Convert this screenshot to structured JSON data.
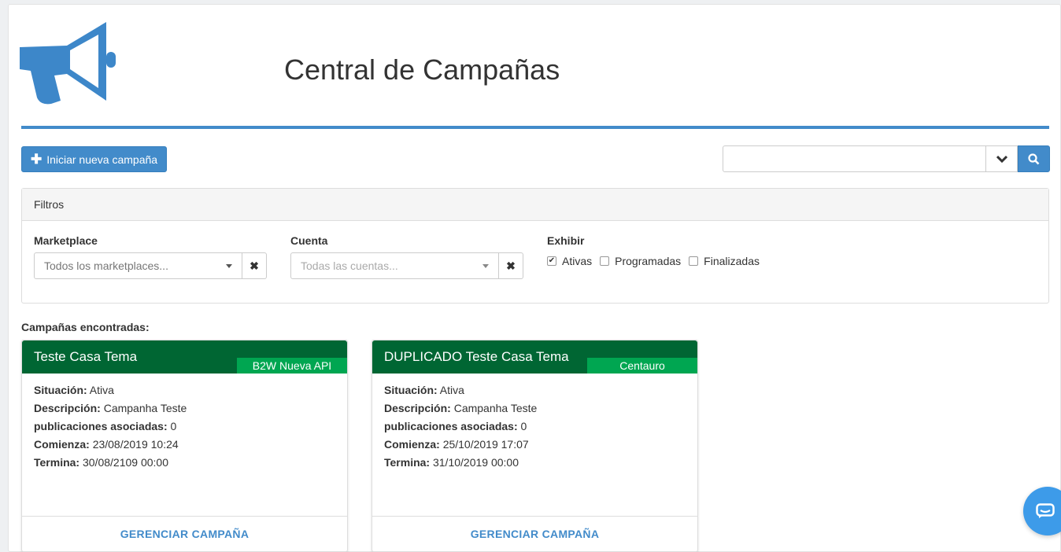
{
  "header": {
    "title": "Central de Campañas",
    "logo_icon": "megaphone-icon"
  },
  "toolbar": {
    "new_campaign_label": "Iniciar nueva campaña",
    "search_value": ""
  },
  "filters": {
    "heading": "Filtros",
    "marketplace_label": "Marketplace",
    "marketplace_placeholder": "Todos los marketplaces...",
    "account_label": "Cuenta",
    "account_placeholder": "Todas las cuentas...",
    "show_label": "Exhibir",
    "options": [
      {
        "label": "Ativas",
        "checked": true
      },
      {
        "label": "Programadas",
        "checked": false
      },
      {
        "label": "Finalizadas",
        "checked": false
      }
    ]
  },
  "results": {
    "heading": "Campañas encontradas:",
    "field_labels": {
      "status": "Situación:",
      "description": "Descripción:",
      "publications": "publicaciones asociadas:",
      "start": "Comienza:",
      "end": "Termina:"
    },
    "campaigns": [
      {
        "title": "Teste Casa Tema",
        "marketplace": "B2W Nueva API",
        "status": "Ativa",
        "description": "Campanha Teste",
        "publications": "0",
        "start": "23/08/2019 10:24",
        "end": "30/08/2109 00:00",
        "action": "GERENCIAR CAMPAÑA"
      },
      {
        "title": "DUPLICADO Teste Casa Tema",
        "marketplace": "Centauro",
        "status": "Ativa",
        "description": "Campanha Teste",
        "publications": "0",
        "start": "25/10/2019 17:07",
        "end": "31/10/2019 00:00",
        "action": "GERENCIAR CAMPAÑA"
      }
    ]
  },
  "colors": {
    "primary": "#428bca",
    "card_header": "#006633",
    "badge": "#00a651",
    "chat": "#3d9be9"
  }
}
